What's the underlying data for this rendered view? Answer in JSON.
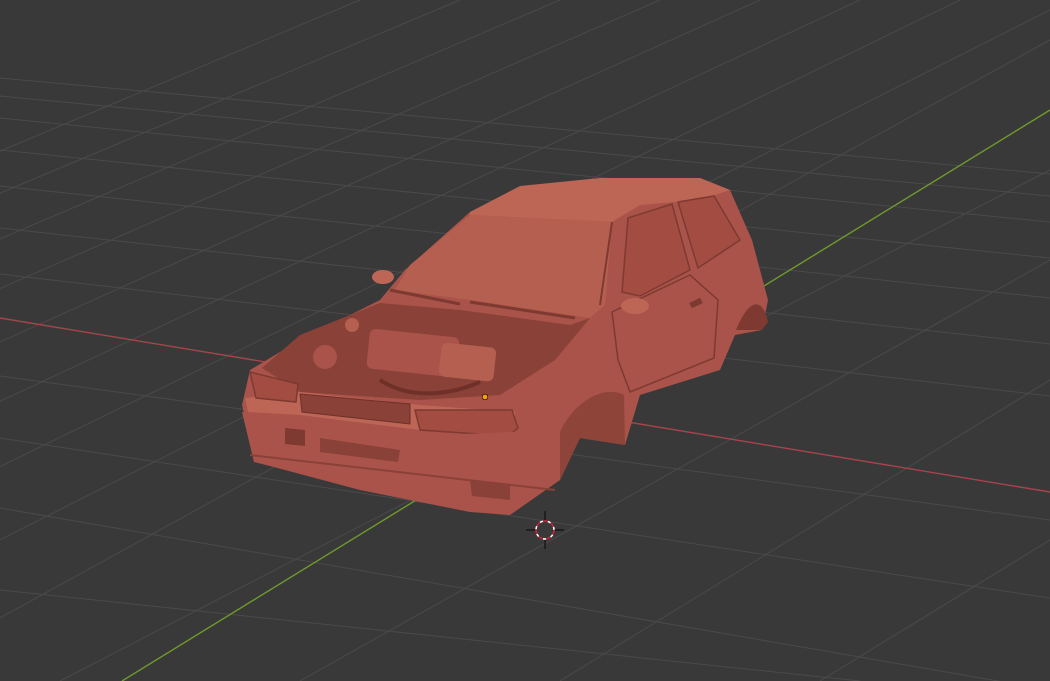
{
  "viewport": {
    "background": "#393939",
    "grid_color": "#4a4a4a",
    "x_axis_color": "#a6444c",
    "y_axis_color": "#6f9a2c",
    "model_color": "#b0564a",
    "model_shadow": "#7e3a31",
    "model_highlight": "#c8705f",
    "cursor_color": "#c8243a",
    "origin_dot_color": "#f5a10a"
  },
  "scene": {
    "object": "hatchback-car-body",
    "cursor": "3d-cursor",
    "origin": "object-origin-dot"
  }
}
